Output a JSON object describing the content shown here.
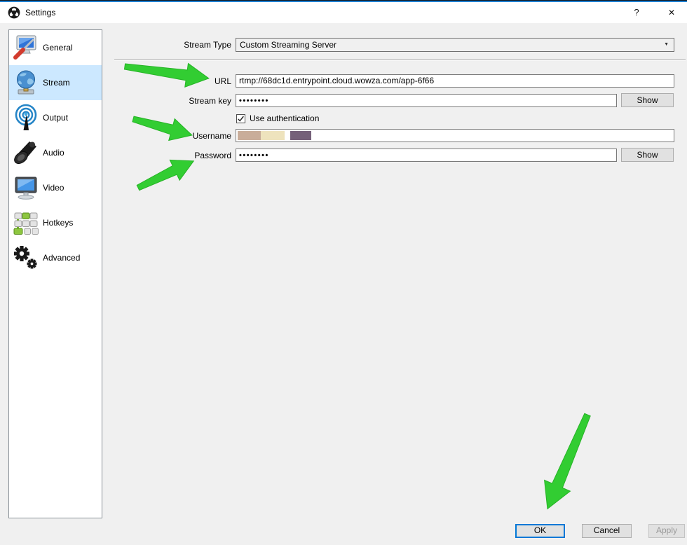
{
  "window": {
    "title": "Settings",
    "help": "?",
    "close": "✕"
  },
  "sidebar": {
    "selected": "Stream",
    "items": [
      {
        "label": "General"
      },
      {
        "label": "Stream"
      },
      {
        "label": "Output"
      },
      {
        "label": "Audio"
      },
      {
        "label": "Video"
      },
      {
        "label": "Hotkeys"
      },
      {
        "label": "Advanced"
      }
    ]
  },
  "form": {
    "stream_type": {
      "label": "Stream Type",
      "value": "Custom Streaming Server"
    },
    "url": {
      "label": "URL",
      "value": "rtmp://68dc1d.entrypoint.cloud.wowza.com/app-6f66"
    },
    "stream_key": {
      "label": "Stream key",
      "value": "••••••••",
      "show": "Show"
    },
    "auth": {
      "label": "Use authentication",
      "checked": true
    },
    "username": {
      "label": "Username",
      "value": "",
      "redaction_blocks": [
        "#c9ad9a",
        "#eee3bd",
        "#756079"
      ]
    },
    "password": {
      "label": "Password",
      "value": "••••••••",
      "show": "Show"
    }
  },
  "footer": {
    "ok": "OK",
    "cancel": "Cancel",
    "apply": "Apply"
  },
  "colors": {
    "accent_blue": "#0078d7",
    "selected_item_bg": "#cce8ff",
    "arrow_green": "#32cd32",
    "window_bg": "#f0f0f0"
  }
}
